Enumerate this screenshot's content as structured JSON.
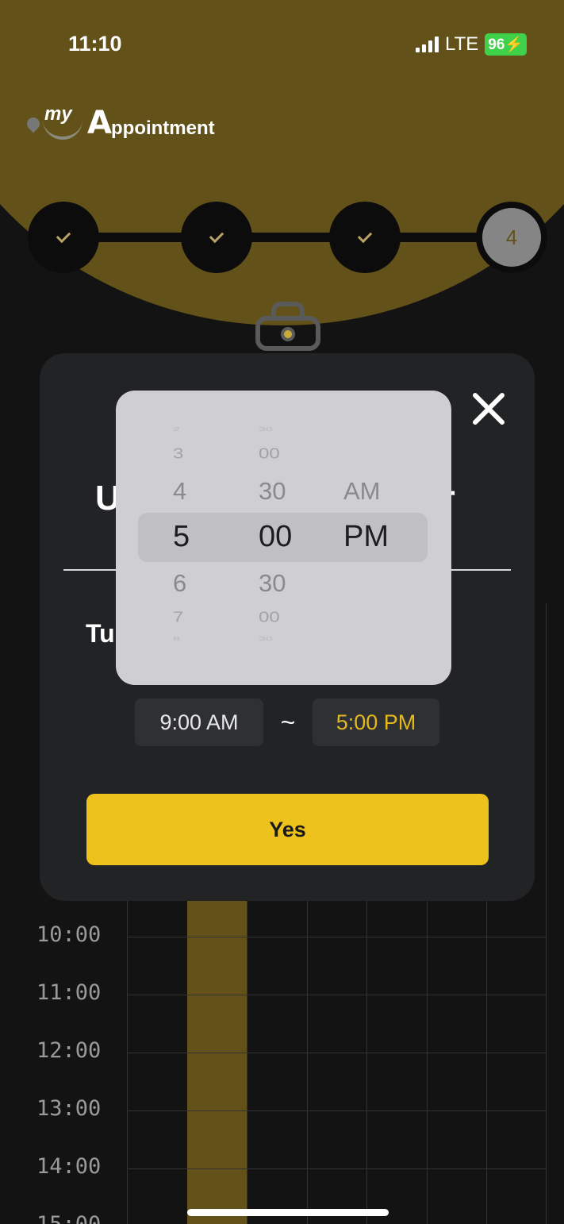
{
  "status_bar": {
    "time": "11:10",
    "network": "LTE",
    "battery": "96"
  },
  "app": {
    "logo_my": "my",
    "logo_initial": "A",
    "logo_rest": "ppointment"
  },
  "stepper": {
    "current_step": "4"
  },
  "schedule": {
    "hours": [
      "10:00",
      "11:00",
      "12:00",
      "13:00",
      "14:00",
      "15:00"
    ]
  },
  "modal": {
    "title_left": "U",
    "title_right": "ur",
    "day_label": "Tu",
    "start_time": "9:00 AM",
    "separator": "~",
    "end_time": "5:00 PM",
    "confirm_label": "Yes"
  },
  "picker": {
    "hours": [
      "2",
      "3",
      "4",
      "5",
      "6",
      "7",
      "8"
    ],
    "minutes": [
      "30",
      "00",
      "30",
      "00",
      "30",
      "00",
      "30"
    ],
    "meridiem": [
      "AM",
      "PM"
    ],
    "selected": {
      "hour": "5",
      "minute": "00",
      "meridiem": "PM"
    }
  },
  "colors": {
    "accent_gold": "#63511a",
    "button_yellow": "#edc21c",
    "end_time_text": "#e4b91f"
  }
}
